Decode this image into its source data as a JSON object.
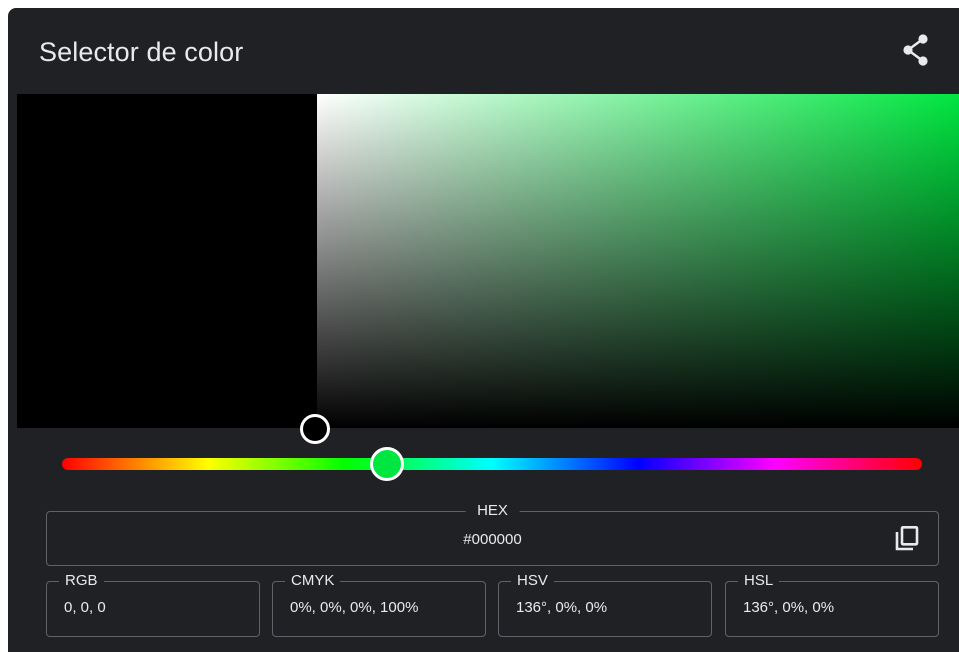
{
  "title": "Selector de color",
  "icons": {
    "share": "share-icon",
    "copy": "copy-icon"
  },
  "colors": {
    "selected": "#000000",
    "hue_pure": "#00e640",
    "background": "#202124"
  },
  "hue_fraction": 0.378,
  "hex": {
    "label": "HEX",
    "value": "#000000"
  },
  "rgb": {
    "label": "RGB",
    "value": "0, 0, 0"
  },
  "cmyk": {
    "label": "CMYK",
    "value": "0%, 0%, 0%, 100%"
  },
  "hsv": {
    "label": "HSV",
    "value": "136°, 0%, 0%"
  },
  "hsl": {
    "label": "HSL",
    "value": "136°, 0%, 0%"
  }
}
